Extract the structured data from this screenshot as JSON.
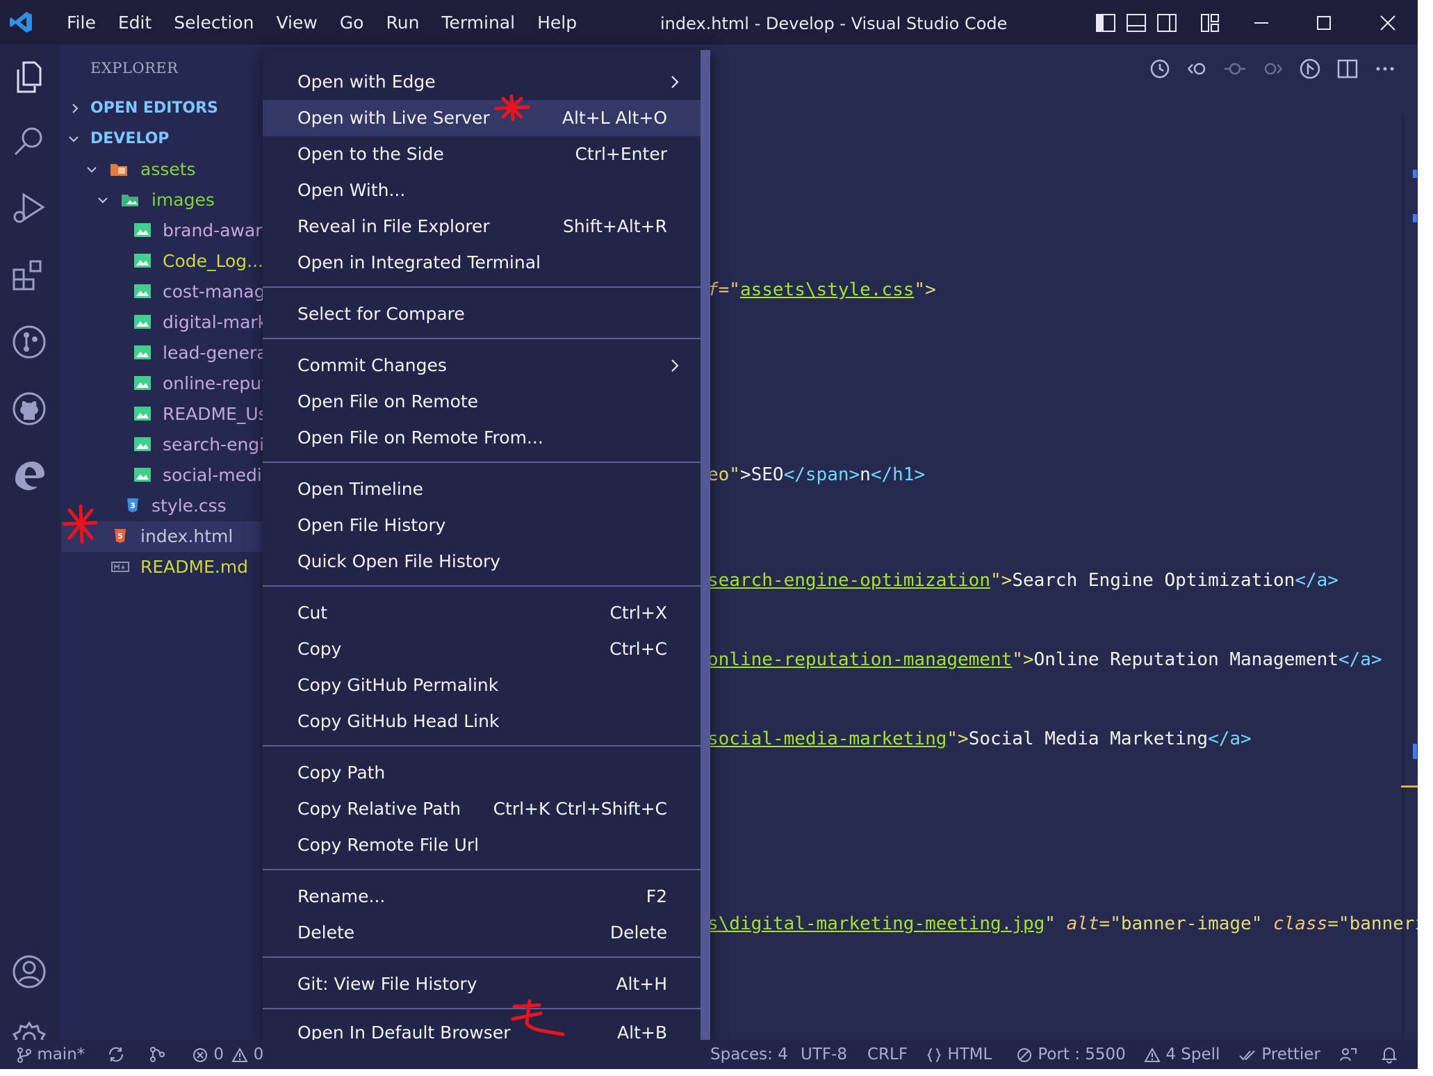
{
  "window": {
    "title": "index.html - Develop - Visual Studio Code",
    "menu": [
      "File",
      "Edit",
      "Selection",
      "View",
      "Go",
      "Run",
      "Terminal",
      "Help"
    ]
  },
  "explorer": {
    "header": "EXPLORER",
    "sections": {
      "open_editors": "OPEN EDITORS",
      "develop": "DEVELOP"
    },
    "folders": {
      "assets": "assets",
      "images": "images"
    },
    "image_files": [
      "brand-aware",
      "Code_Log...",
      "cost-manage",
      "digital-marke",
      "lead-generat",
      "online-reput",
      "README_Us",
      "search-engir",
      "social-media"
    ],
    "style_file": "style.css",
    "index_file": "index.html",
    "readme_file": "README.md"
  },
  "context_menu": {
    "items": [
      {
        "label": "Open with Edge",
        "key": "",
        "submenu": true
      },
      {
        "label": "Open with Live Server",
        "key": "Alt+L Alt+O",
        "highlighted": true
      },
      {
        "label": "Open to the Side",
        "key": "Ctrl+Enter"
      },
      {
        "label": "Open With...",
        "key": ""
      },
      {
        "label": "Reveal in File Explorer",
        "key": "Shift+Alt+R"
      },
      {
        "label": "Open in Integrated Terminal",
        "key": ""
      },
      {
        "label": "Select for Compare",
        "key": ""
      },
      {
        "label": "Commit Changes",
        "key": "",
        "submenu": true
      },
      {
        "label": "Open File on Remote",
        "key": ""
      },
      {
        "label": "Open File on Remote From...",
        "key": ""
      },
      {
        "label": "Open Timeline",
        "key": ""
      },
      {
        "label": "Open File History",
        "key": ""
      },
      {
        "label": "Quick Open File History",
        "key": ""
      },
      {
        "label": "Cut",
        "key": "Ctrl+X"
      },
      {
        "label": "Copy",
        "key": "Ctrl+C"
      },
      {
        "label": "Copy GitHub Permalink",
        "key": ""
      },
      {
        "label": "Copy GitHub Head Link",
        "key": ""
      },
      {
        "label": "Copy Path",
        "key": ""
      },
      {
        "label": "Copy Relative Path",
        "key": "Ctrl+K Ctrl+Shift+C"
      },
      {
        "label": "Copy Remote File Url",
        "key": ""
      },
      {
        "label": "Rename...",
        "key": "F2"
      },
      {
        "label": "Delete",
        "key": "Delete"
      },
      {
        "label": "Git: View File History",
        "key": "Alt+H"
      },
      {
        "label": "Open In Default Browser",
        "key": "Alt+B"
      }
    ]
  },
  "code": {
    "l1_a": "f=\"",
    "l1_b": "assets\\style.css",
    "l1_c": "\">",
    "l2_a": "eo\"",
    "l2_b": ">SEO",
    "l2_c": "</span>",
    "l2_d": "n",
    "l2_e": "</h1>",
    "l3_a": "search-engine-optimization",
    "l3_b": "\">",
    "l3_c": "Search Engine Optimization",
    "l3_d": "</a>",
    "l4_a": "online-reputation-management",
    "l4_b": "\">",
    "l4_c": "Online Reputation Management",
    "l4_d": "</a>",
    "l5_a": "social-media-marketing",
    "l5_b": "\">",
    "l5_c": "Social Media Marketing",
    "l5_d": "</a>",
    "l6_a": "s\\digital-marketing-meeting.jpg",
    "l6_b": "\" ",
    "l6_c": "alt",
    "l6_d": "=\"banner-image\" ",
    "l6_e": "class",
    "l6_f": "=\"bannerima"
  },
  "status": {
    "branch": "main*",
    "errors": "0",
    "warnings": "0",
    "spaces": "Spaces: 4",
    "encoding": "UTF-8",
    "eol": "CRLF",
    "language": "HTML",
    "port": "Port : 5500",
    "spell": "4 Spell",
    "prettier": "Prettier"
  },
  "colors": {
    "background": "#262a4f",
    "titlebar": "#1c1e3a",
    "menu": "#232548",
    "folder_text": "#7fd33b",
    "file_text": "#c5a7e0",
    "modified_text": "#cdd83a",
    "annotation": "#e8141e"
  }
}
